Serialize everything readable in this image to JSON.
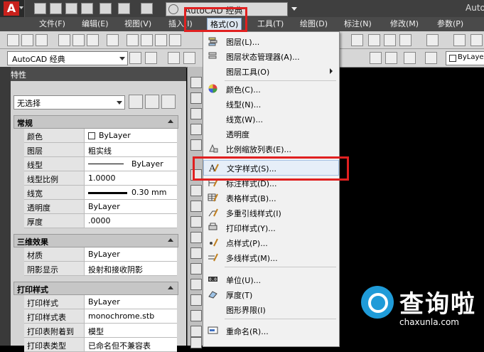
{
  "titlebar": {
    "app_logo": "A",
    "workspace_title": "AutoCAD 经典",
    "app_name": "Auto"
  },
  "menubar": {
    "items": [
      "文件(F)",
      "编辑(E)",
      "视图(V)",
      "插入(I)",
      "格式(O)",
      "工具(T)",
      "绘图(D)",
      "标注(N)",
      "修改(M)",
      "参数(P)"
    ]
  },
  "toolbar": {
    "workspace_combo": "AutoCAD 经典",
    "layer_combo": "ByLayer"
  },
  "properties": {
    "title": "特性",
    "selection": "无选择",
    "sections": [
      {
        "title": "常规",
        "rows": [
          {
            "key": "颜色",
            "value": "ByLayer"
          },
          {
            "key": "图层",
            "value": "粗实线"
          },
          {
            "key": "线型",
            "value": "ByLayer"
          },
          {
            "key": "线型比例",
            "value": "1.0000"
          },
          {
            "key": "线宽",
            "value": "0.30 mm"
          },
          {
            "key": "透明度",
            "value": "ByLayer"
          },
          {
            "key": "厚度",
            "value": ".0000"
          }
        ]
      },
      {
        "title": "三维效果",
        "rows": [
          {
            "key": "材质",
            "value": "ByLayer"
          },
          {
            "key": "阴影显示",
            "value": "投射和接收阴影"
          }
        ]
      },
      {
        "title": "打印样式",
        "rows": [
          {
            "key": "打印样式",
            "value": "ByLayer"
          },
          {
            "key": "打印样式表",
            "value": "monochrome.stb"
          },
          {
            "key": "打印表附着到",
            "value": "模型"
          },
          {
            "key": "打印表类型",
            "value": "已命名但不兼容表"
          }
        ]
      }
    ]
  },
  "format_menu": {
    "items": [
      {
        "label": "图层(L)...",
        "icon": "layer-icon"
      },
      {
        "label": "图层状态管理器(A)...",
        "icon": "layer-state-icon"
      },
      {
        "label": "图层工具(O)",
        "icon": "",
        "submenu": true
      },
      {
        "label": "颜色(C)...",
        "icon": "color-wheel-icon"
      },
      {
        "label": "线型(N)...",
        "icon": ""
      },
      {
        "label": "线宽(W)...",
        "icon": ""
      },
      {
        "label": "透明度",
        "icon": ""
      },
      {
        "label": "比例缩放列表(E)...",
        "icon": "scale-list-icon"
      },
      {
        "label": "文字样式(S)...",
        "icon": "text-style-icon"
      },
      {
        "label": "标注样式(D)...",
        "icon": "dim-style-icon"
      },
      {
        "label": "表格样式(B)...",
        "icon": "table-style-icon"
      },
      {
        "label": "多重引线样式(I)",
        "icon": "mleader-style-icon"
      },
      {
        "label": "打印样式(Y)...",
        "icon": "plot-style-icon"
      },
      {
        "label": "点样式(P)...",
        "icon": "point-style-icon"
      },
      {
        "label": "多线样式(M)...",
        "icon": "mline-style-icon"
      },
      {
        "label": "单位(U)...",
        "icon": "units-icon"
      },
      {
        "label": "厚度(T)",
        "icon": "thickness-icon"
      },
      {
        "label": "图形界限(I)",
        "icon": ""
      },
      {
        "label": "重命名(R)...",
        "icon": "rename-icon"
      }
    ]
  },
  "watermark": {
    "cn": "查询啦",
    "en": "chaxunla.com"
  },
  "colors": {
    "highlight_red": "#e02020",
    "menu_bg": "#f1f1f1",
    "title_bg": "#3f3f3f"
  }
}
